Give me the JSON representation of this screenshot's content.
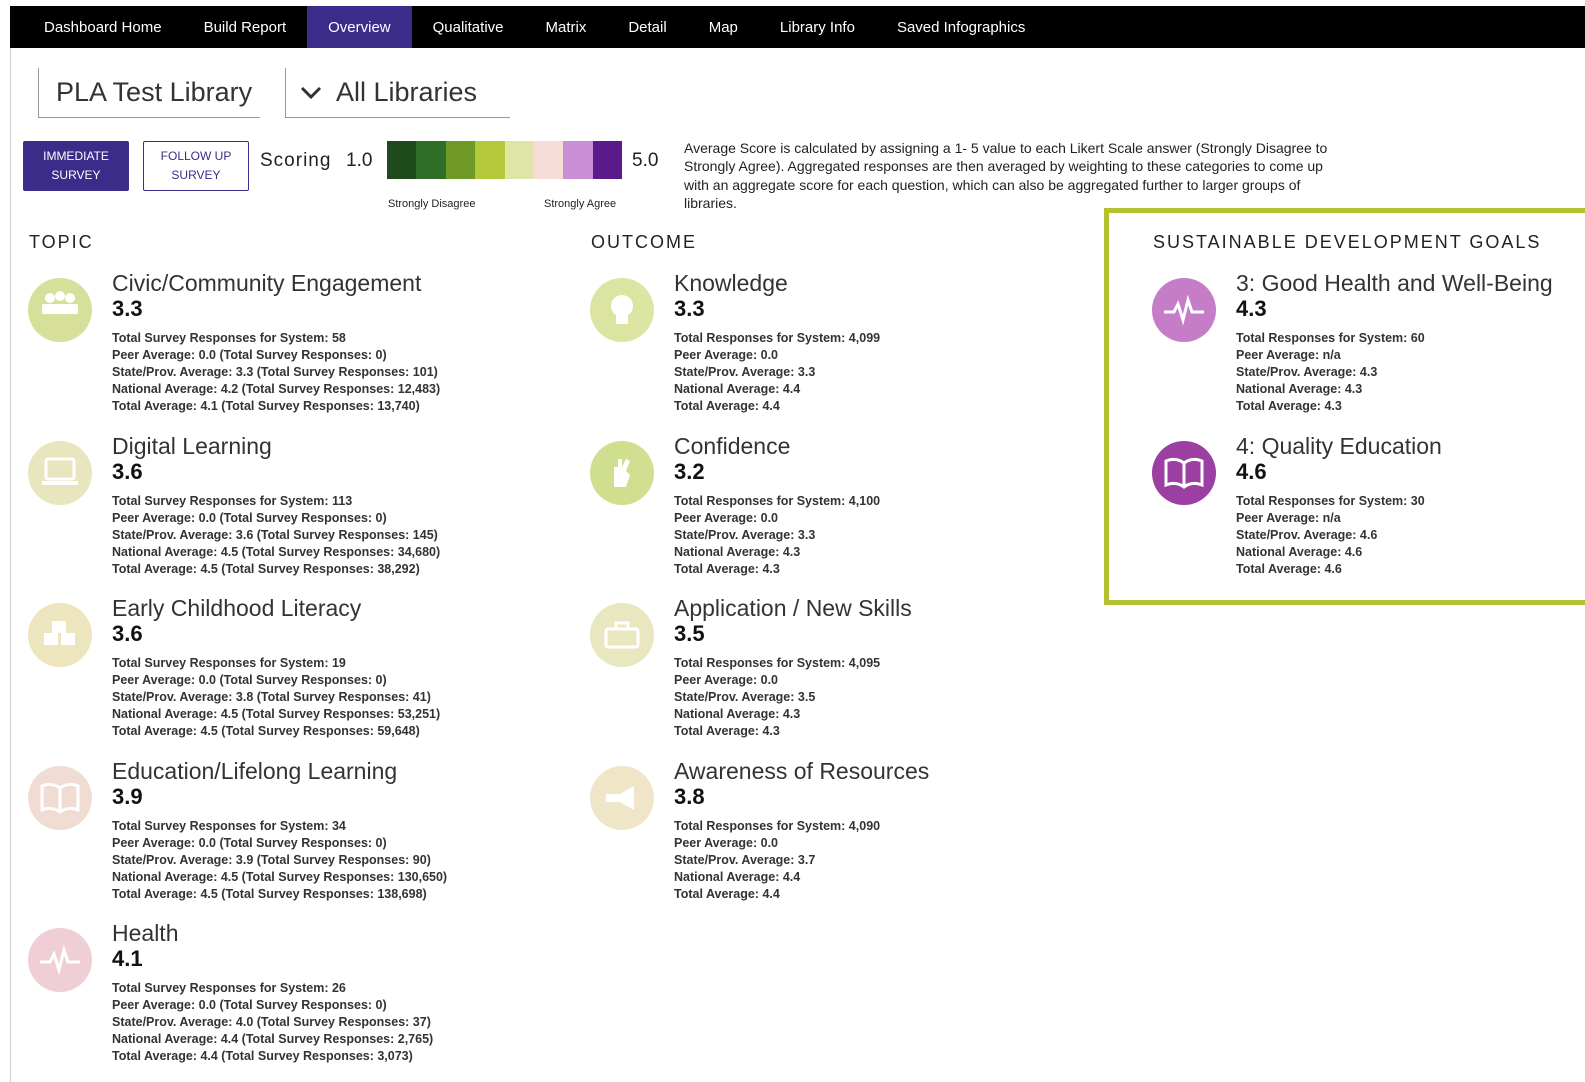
{
  "nav": {
    "items": [
      "Dashboard Home",
      "Build Report",
      "Overview",
      "Qualitative",
      "Matrix",
      "Detail",
      "Map",
      "Library Info",
      "Saved Infographics"
    ],
    "active": "Overview",
    "active_color": "#3b2c8a"
  },
  "library_selector": "PLA Test Library",
  "comparison_selector": "All Libraries",
  "survey_buttons": {
    "immediate": "IMMEDIATE SURVEY",
    "follow_up": "FOLLOW UP SURVEY"
  },
  "scoring": {
    "label": "Scoring",
    "min": "1.0",
    "max": "5.0",
    "low_label": "Strongly Disagree",
    "high_label": "Strongly Agree",
    "colors": [
      "#1e4a1c",
      "#2f6e27",
      "#6f9a25",
      "#b5c83a",
      "#dfe5a6",
      "#f6dcd6",
      "#c98ed6",
      "#5a1a8c"
    ]
  },
  "explainer": "Average Score is calculated by assigning a 1- 5 value to each Likert Scale answer (Strongly Disagree to Strongly Agree). Aggregated responses are then averaged by weighting to these categories to come up with an aggregate score for each question, which can also be aggregated further to larger groups of libraries.",
  "headings": {
    "topic": "TOPIC",
    "outcome": "OUTCOME",
    "sdg": "SUSTAINABLE DEVELOPMENT GOALS"
  },
  "accent_colors": {
    "sdg_border": "#b4c232",
    "sdg_icon": "#a64aa8"
  },
  "topics": [
    {
      "title": "Civic/Community Engagement",
      "score": "3.3",
      "icon": "people-icon",
      "color": "#b7c84a",
      "stats": [
        "Total Survey Responses for System: 58",
        "Peer Average: 0.0 (Total Survey Responses: 0)",
        "State/Prov. Average: 3.3 (Total Survey Responses: 101)",
        "National Average: 4.2 (Total Survey Responses: 12,483)",
        "Total Average: 4.1 (Total Survey Responses: 13,740)"
      ]
    },
    {
      "title": "Digital Learning",
      "score": "3.6",
      "icon": "laptop-icon",
      "color": "#d6d38a",
      "stats": [
        "Total Survey Responses for System: 113",
        "Peer Average: 0.0 (Total Survey Responses: 0)",
        "State/Prov. Average: 3.6 (Total Survey Responses: 145)",
        "National Average: 4.5 (Total Survey Responses: 34,680)",
        "Total Average: 4.5 (Total Survey Responses: 38,292)"
      ]
    },
    {
      "title": "Early Childhood Literacy",
      "score": "3.6",
      "icon": "blocks-icon",
      "color": "#ddd18a",
      "stats": [
        "Total Survey Responses for System: 19",
        "Peer Average: 0.0 (Total Survey Responses: 0)",
        "State/Prov. Average: 3.8 (Total Survey Responses: 41)",
        "National Average: 4.5 (Total Survey Responses: 53,251)",
        "Total Average: 4.5 (Total Survey Responses: 59,648)"
      ]
    },
    {
      "title": "Education/Lifelong Learning",
      "score": "3.9",
      "icon": "book-icon",
      "color": "#e4c0b0",
      "stats": [
        "Total Survey Responses for System: 34",
        "Peer Average: 0.0 (Total Survey Responses: 0)",
        "State/Prov. Average: 3.9 (Total Survey Responses: 90)",
        "National Average: 4.5 (Total Survey Responses: 130,650)",
        "Total Average: 4.5 (Total Survey Responses: 138,698)"
      ]
    },
    {
      "title": "Health",
      "score": "4.1",
      "icon": "heartbeat-icon",
      "color": "#e2a9b4",
      "stats": [
        "Total Survey Responses for System: 26",
        "Peer Average: 0.0 (Total Survey Responses: 0)",
        "State/Prov. Average: 4.0 (Total Survey Responses: 37)",
        "National Average: 4.4 (Total Survey Responses: 2,765)",
        "Total Average: 4.4 (Total Survey Responses: 3,073)"
      ]
    }
  ],
  "outcomes": [
    {
      "title": "Knowledge",
      "score": "3.3",
      "icon": "head-icon",
      "color": "#bfd155",
      "stats": [
        "Total Responses for System: 4,099",
        "Peer Average: 0.0",
        "State/Prov. Average: 3.3",
        "National Average: 4.4",
        "Total Average: 4.4"
      ]
    },
    {
      "title": "Confidence",
      "score": "3.2",
      "icon": "hand-icon",
      "color": "#aac435",
      "stats": [
        "Total Responses for System: 4,100",
        "Peer Average: 0.0",
        "State/Prov. Average: 3.3",
        "National Average: 4.3",
        "Total Average: 4.3"
      ]
    },
    {
      "title": "Application / New Skills",
      "score": "3.5",
      "icon": "toolbox-icon",
      "color": "#d6d58c",
      "stats": [
        "Total Responses for System: 4,095",
        "Peer Average: 0.0",
        "State/Prov. Average: 3.5",
        "National Average: 4.3",
        "Total Average: 4.3"
      ]
    },
    {
      "title": "Awareness of Resources",
      "score": "3.8",
      "icon": "megaphone-icon",
      "color": "#e3d09a",
      "stats": [
        "Total Responses for System: 4,090",
        "Peer Average: 0.0",
        "State/Prov. Average: 3.7",
        "National Average: 4.4",
        "Total Average: 4.4"
      ]
    }
  ],
  "sdgs": [
    {
      "title": "3: Good Health and Well-Being",
      "score": "4.3",
      "icon": "heartbeat-icon",
      "color": "#c57dc8",
      "stats": [
        "Total Responses for System: 60",
        "Peer Average: n/a",
        "State/Prov. Average: 4.3",
        "National Average: 4.3",
        "Total Average: 4.3"
      ]
    },
    {
      "title": "4: Quality Education",
      "score": "4.6",
      "icon": "book-icon",
      "color": "#9b3fa3",
      "stats": [
        "Total Responses for System: 30",
        "Peer Average: n/a",
        "State/Prov. Average: 4.6",
        "National Average: 4.6",
        "Total Average: 4.6"
      ]
    }
  ]
}
